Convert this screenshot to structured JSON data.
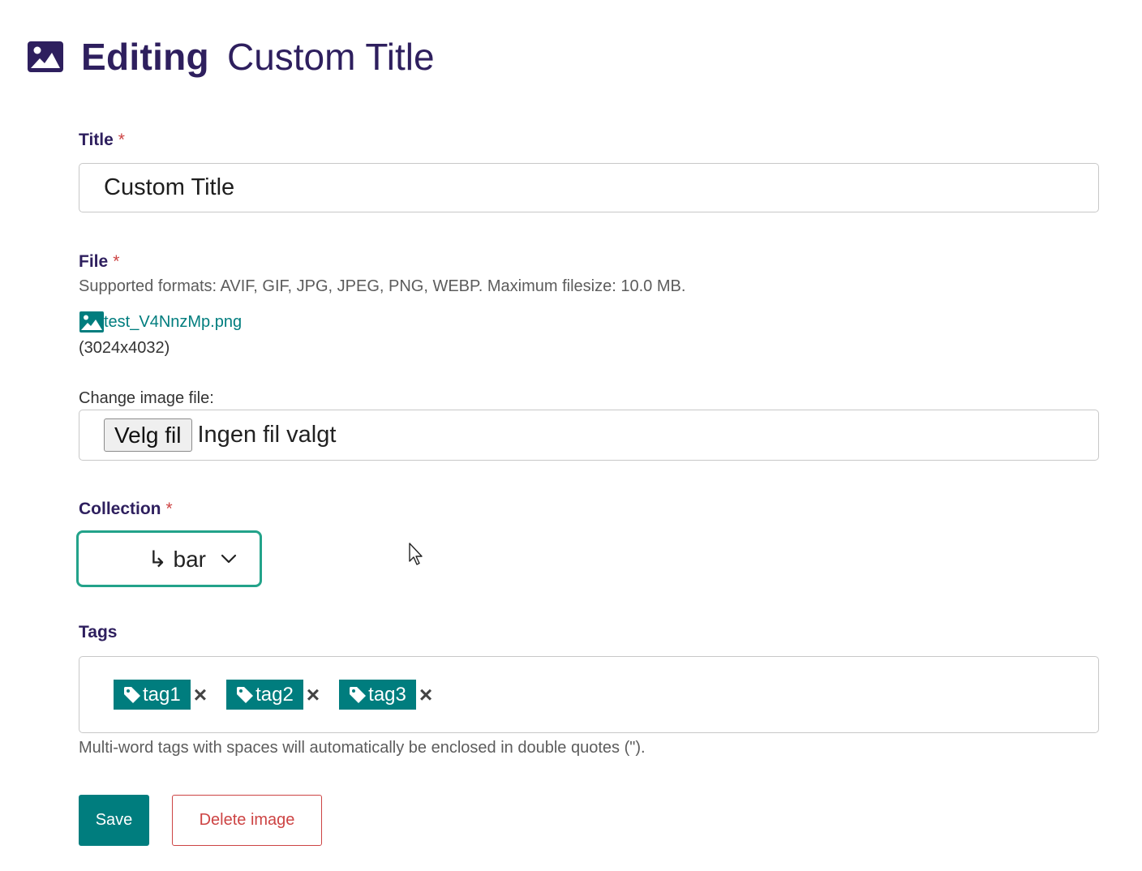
{
  "header": {
    "action": "Editing",
    "title": "Custom Title",
    "icon": "image-icon"
  },
  "form": {
    "title_field": {
      "label": "Title",
      "required_mark": "*",
      "value": "Custom Title"
    },
    "file_field": {
      "label": "File",
      "required_mark": "*",
      "help": "Supported formats: AVIF, GIF, JPG, JPEG, PNG, WEBP. Maximum filesize: 10.0 MB.",
      "current_file": "test_V4NnzMp.png",
      "dimensions": "(3024x4032)",
      "change_label": "Change image file:",
      "choose_button": "Velg fil",
      "no_file_text": "Ingen fil valgt"
    },
    "collection_field": {
      "label": "Collection",
      "required_mark": "*",
      "selected": "↳ bar"
    },
    "tags_field": {
      "label": "Tags",
      "tags": [
        {
          "label": "tag1"
        },
        {
          "label": "tag2"
        },
        {
          "label": "tag3"
        }
      ],
      "remove_symbol": "×",
      "help": "Multi-word tags with spaces will automatically be enclosed in double quotes (\")."
    }
  },
  "actions": {
    "save": "Save",
    "delete": "Delete image"
  },
  "colors": {
    "primary": "#007d7e",
    "heading": "#2e1f5e",
    "danger": "#cd4444",
    "focus": "#23a38a"
  }
}
